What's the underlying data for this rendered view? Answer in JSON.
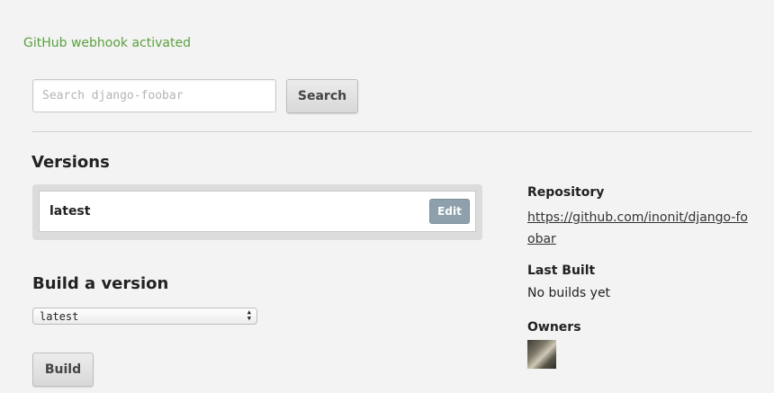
{
  "notice": {
    "text": "GitHub webhook activated"
  },
  "search": {
    "placeholder": "Search django-foobar",
    "button_label": "Search"
  },
  "versions": {
    "heading": "Versions",
    "items": [
      {
        "name": "latest",
        "edit_label": "Edit"
      }
    ]
  },
  "build": {
    "heading": "Build a version",
    "selected": "latest",
    "button_label": "Build"
  },
  "sidebar": {
    "repository_label": "Repository",
    "repository_url": "https://github.com/inonit/django-foobar",
    "last_built_label": "Last Built",
    "last_built_value": "No builds yet",
    "owners_label": "Owners"
  },
  "colors": {
    "notice": "#5aa13f",
    "edit_button": "#8fa0ad",
    "background": "#f3f3f3"
  }
}
